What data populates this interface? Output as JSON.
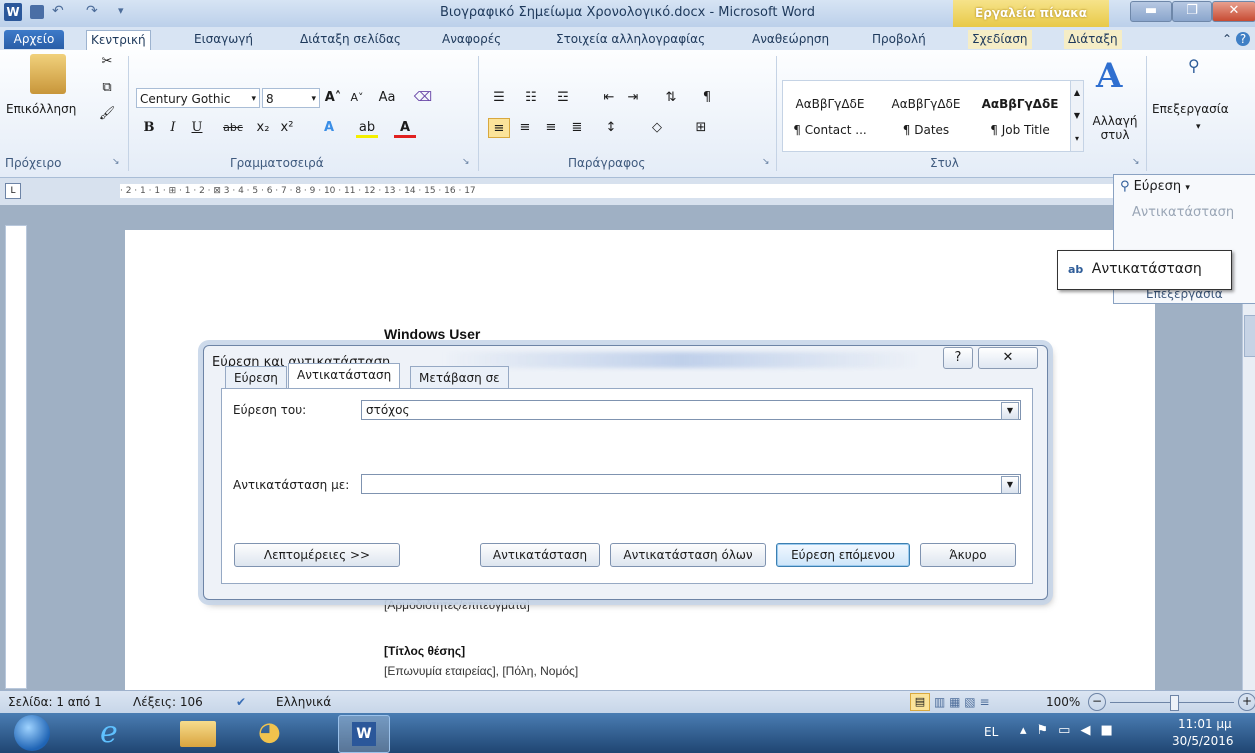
{
  "window": {
    "title": "Βιογραφικό Σημείωμα Χρονολογικό.docx - Microsoft Word",
    "context_tab_group": "Εργαλεία πίνακα",
    "app_icon": "W"
  },
  "tabs": {
    "file": "Αρχείο",
    "home": "Κεντρική",
    "insert": "Εισαγωγή",
    "layout": "Διάταξη σελίδας",
    "references": "Αναφορές",
    "mailings": "Στοιχεία αλληλογραφίας",
    "review": "Αναθεώρηση",
    "view": "Προβολή",
    "design": "Σχεδίαση",
    "table_layout": "Διάταξη"
  },
  "ribbon": {
    "clipboard": {
      "paste": "Επικόλληση",
      "label": "Πρόχειρο"
    },
    "font": {
      "name": "Century Gothic",
      "size": "8",
      "label": "Γραμματοσειρά"
    },
    "paragraph": {
      "label": "Παράγραφος"
    },
    "styles": {
      "items": [
        {
          "preview": "ΑαΒβΓγΔδΕ",
          "name": "¶ Contact ..."
        },
        {
          "preview": "ΑαΒβΓγΔδΕ",
          "name": "¶ Dates"
        },
        {
          "preview": "ΑαΒβΓγΔδΕ",
          "name": "¶ Job Title"
        }
      ],
      "change_styles": "Αλλαγή στυλ",
      "label": "Στυλ"
    },
    "editing": {
      "label": "Επεξεργασία"
    }
  },
  "find_popup": {
    "find": "Εύρεση",
    "replace": "Αντικατάσταση",
    "replace_callout": "Αντικατάσταση",
    "group_label": "Επεξεργασία"
  },
  "document": {
    "heading": "Windows User",
    "line1": "[Αρμοδιότητες/επιτεύγματα]",
    "line2": "[Τίτλος θέσης]",
    "line3": "[Επωνυμία εταιρείας], [Πόλη, Νομός]"
  },
  "dialog": {
    "title": "Εύρεση και αντικατάσταση",
    "help": "?",
    "close": "✕",
    "tabs": [
      "Εύρεση",
      "Αντικατάσταση",
      "Μετάβαση σε"
    ],
    "find_label": "Εύρεση του:",
    "find_value": "στόχος",
    "replace_label": "Αντικατάσταση με:",
    "replace_value": "",
    "more_button": "Λεπτομέρειες >>",
    "replace_button": "Αντικατάσταση",
    "replace_all_button": "Αντικατάσταση όλων",
    "find_next_button": "Εύρεση επόμενου",
    "cancel_button": "Άκυρο"
  },
  "status": {
    "page": "Σελίδα: 1 από 1",
    "words": "Λέξεις: 106",
    "language": "Ελληνικά",
    "zoom": "100%"
  },
  "taskbar": {
    "lang": "EL",
    "time": "11:01 μμ",
    "date": "30/5/2016"
  },
  "colors": {
    "accent": "#2b579a",
    "context_tab": "#e8c948"
  }
}
